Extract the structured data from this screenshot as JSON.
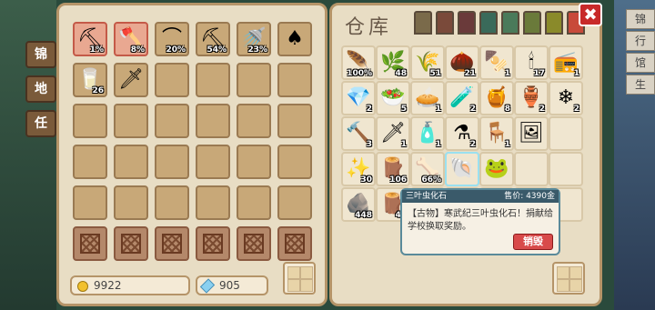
{
  "side_tabs_left": [
    "锦",
    "地",
    "任"
  ],
  "side_tabs_right": [
    "锦",
    "行",
    "馆",
    "生"
  ],
  "storage": {
    "title": "仓库",
    "ribbon_colors": [
      "#7a6a4a",
      "#7a4a3a",
      "#6a3a3a",
      "#3a6a5a",
      "#4a7a5a",
      "#6a7a3a",
      "#8a8a2a",
      "#c84a3a"
    ]
  },
  "close_label": "✖",
  "currency": {
    "gold": "9922",
    "gems": "905"
  },
  "left_items": [
    {
      "glyph": "⛏",
      "count": "1%",
      "eq": true,
      "name": "pickaxe-icon"
    },
    {
      "glyph": "🪓",
      "count": "8%",
      "eq": true,
      "name": "axe-icon"
    },
    {
      "glyph": "⌒",
      "count": "20%",
      "eq": false,
      "name": "sickle-icon"
    },
    {
      "glyph": "⛏",
      "count": "54%",
      "eq": false,
      "name": "hoe-icon"
    },
    {
      "glyph": "🚿",
      "count": "23%",
      "eq": false,
      "name": "watering-can-icon"
    },
    {
      "glyph": "♠",
      "count": "",
      "eq": false,
      "name": "shovel-icon"
    },
    {
      "glyph": "🥛",
      "count": "26",
      "eq": false,
      "name": "milk-bottle-icon"
    },
    {
      "glyph": "🗡",
      "count": "",
      "eq": false,
      "name": "sword-icon"
    }
  ],
  "right_items": [
    {
      "glyph": "🪶",
      "count": "100%",
      "name": "fishing-rod-icon"
    },
    {
      "glyph": "🌿",
      "count": "48",
      "name": "herb-icon"
    },
    {
      "glyph": "🌾",
      "count": "51",
      "name": "wheat-icon"
    },
    {
      "glyph": "🌰",
      "count": "21",
      "name": "acorn-icon"
    },
    {
      "glyph": "🍢",
      "count": "1",
      "name": "skewer-icon"
    },
    {
      "glyph": "🕯",
      "count": "17",
      "name": "candle-icon"
    },
    {
      "glyph": "📻",
      "count": "1",
      "name": "radio-icon"
    },
    {
      "glyph": "💎",
      "count": "2",
      "name": "diamond-icon"
    },
    {
      "glyph": "🥗",
      "count": "5",
      "name": "salad-icon"
    },
    {
      "glyph": "🥧",
      "count": "1",
      "name": "pie-icon"
    },
    {
      "glyph": "🧪",
      "count": "2",
      "name": "potion-bag-icon"
    },
    {
      "glyph": "🍯",
      "count": "8",
      "name": "honey-jar-icon"
    },
    {
      "glyph": "🏺",
      "count": "2",
      "name": "barrel-icon"
    },
    {
      "glyph": "❄",
      "count": "2",
      "name": "ice-block-icon"
    },
    {
      "glyph": "🔨",
      "count": "3",
      "name": "hammer-icon"
    },
    {
      "glyph": "🗡",
      "count": "1",
      "name": "dagger-icon"
    },
    {
      "glyph": "🧴",
      "count": "1",
      "name": "bottle-icon"
    },
    {
      "glyph": "⚗",
      "count": "2",
      "name": "flask-icon"
    },
    {
      "glyph": "🪑",
      "count": "1",
      "name": "anvil-icon"
    },
    {
      "glyph": "🖼",
      "count": "",
      "name": "painting-icon"
    },
    {
      "glyph": "",
      "count": "",
      "name": "empty-slot"
    },
    {
      "glyph": "✨",
      "count": "30",
      "name": "sparkle-dust-icon"
    },
    {
      "glyph": "🪵",
      "count": "106",
      "name": "wood-log-icon"
    },
    {
      "glyph": "🦴",
      "count": "66%",
      "name": "bone-icon"
    },
    {
      "glyph": "🐚",
      "count": "",
      "name": "trilobite-fossil-icon",
      "selected": true
    },
    {
      "glyph": "🐸",
      "count": "",
      "name": "frog-icon"
    },
    {
      "glyph": "",
      "count": "",
      "name": "empty-slot"
    },
    {
      "glyph": "",
      "count": "",
      "name": "empty-slot"
    },
    {
      "glyph": "🪨",
      "count": "448",
      "name": "stone-icon"
    },
    {
      "glyph": "🪵",
      "count": "44",
      "name": "branch-icon"
    }
  ],
  "tooltip": {
    "name": "三叶虫化石",
    "price": "售价: 4390金",
    "desc": "【古物】寒武纪三叶虫化石！捐献给学校换取奖励。",
    "sell_label": "销毁"
  }
}
